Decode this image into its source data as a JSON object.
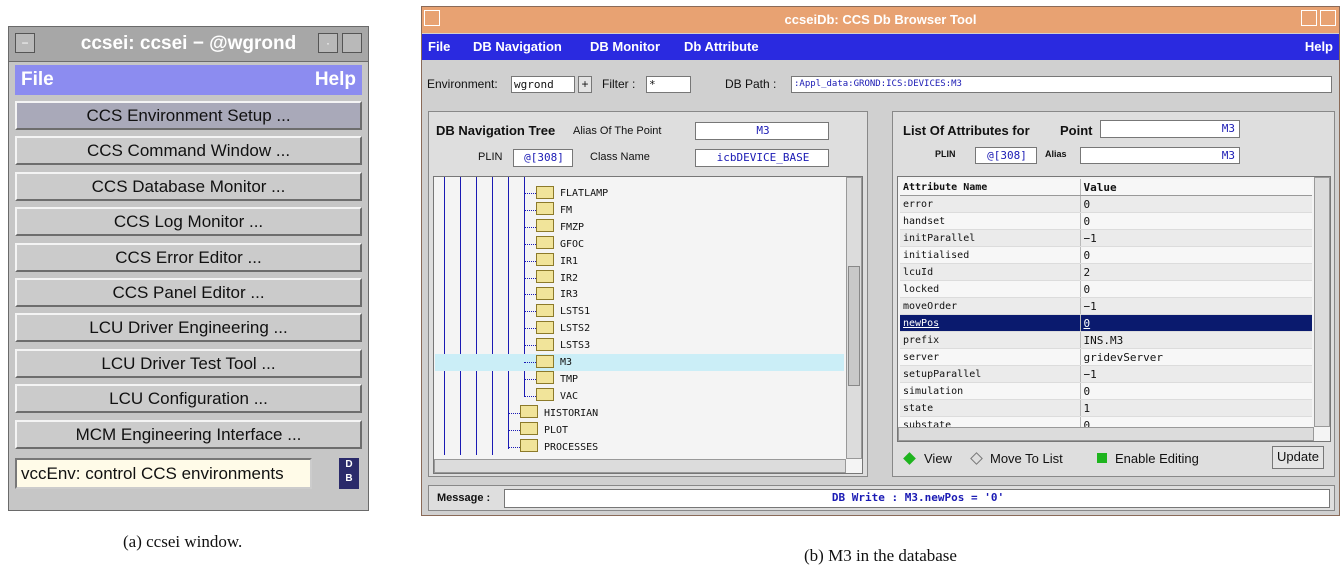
{
  "window_a": {
    "title": "ccsei: ccsei − @wgrond",
    "menu": {
      "file": "File",
      "help": "Help"
    },
    "items": [
      "CCS Environment Setup ...",
      "CCS Command Window ...",
      "CCS Database Monitor ...",
      "CCS Log Monitor ...",
      "CCS Error Editor ...",
      "CCS Panel Editor ...",
      "LCU Driver Engineering ...",
      "LCU Driver Test Tool ...",
      "LCU Configuration ...",
      "MCM Engineering Interface ..."
    ],
    "status": "vccEnv: control CCS environments",
    "logo": "DB"
  },
  "window_b": {
    "title": "ccseiDb: CCS Db Browser Tool",
    "menu": {
      "file": "File",
      "nav": "DB Navigation",
      "monitor": "DB Monitor",
      "attribute": "Db Attribute",
      "help": "Help"
    },
    "environment": {
      "label": "Environment:",
      "value": "wgrond",
      "plus": "+"
    },
    "filter": {
      "label": "Filter :",
      "value": "*"
    },
    "dbpath": {
      "label": "DB Path :",
      "value": ":Appl_data:GROND:ICS:DEVICES:M3"
    },
    "nav": {
      "heading": "DB Navigation Tree",
      "alias_label": "Alias Of The Point",
      "alias_value": "M3",
      "plin_label": "PLIN",
      "plin_value": "@[308]",
      "class_label": "Class Name",
      "class_value": "icbDEVICE_BASE",
      "tree": [
        "FLATLAMP",
        "FM",
        "FMZP",
        "GFOC",
        "IR1",
        "IR2",
        "IR3",
        "LSTS1",
        "LSTS2",
        "LSTS3",
        "M3",
        "TMP",
        "VAC",
        "HISTORIAN",
        "PLOT",
        "PROCESSES"
      ],
      "selected": "M3"
    },
    "attrs": {
      "heading": "List Of Attributes for",
      "point_label": "Point",
      "point_value": "M3",
      "plin_label": "PLIN",
      "plin_value": "@[308]",
      "alias_label": "Alias",
      "alias_value": "M3",
      "col_name": "Attribute Name",
      "col_value": "Value",
      "rows": [
        [
          "error",
          "0"
        ],
        [
          "handset",
          "0"
        ],
        [
          "initParallel",
          "−1"
        ],
        [
          "initialised",
          "0"
        ],
        [
          "lcuId",
          "2"
        ],
        [
          "locked",
          "0"
        ],
        [
          "moveOrder",
          "−1"
        ],
        [
          "newPos",
          "0"
        ],
        [
          "prefix",
          "INS.M3"
        ],
        [
          "server",
          "gridevServer"
        ],
        [
          "setupParallel",
          "−1"
        ],
        [
          "simulation",
          "0"
        ],
        [
          "state",
          "1"
        ],
        [
          "substate",
          "0"
        ]
      ],
      "selected_row": "newPos",
      "view": "View",
      "move_to_list": "Move To List",
      "enable_editing": "Enable Editing",
      "update": "Update"
    },
    "message": {
      "label": "Message :",
      "value": "DB Write :  M3.newPos = '0'"
    }
  },
  "captions": {
    "a": "(a)  ccsei window.",
    "b": "(b)  M3 in the database"
  }
}
